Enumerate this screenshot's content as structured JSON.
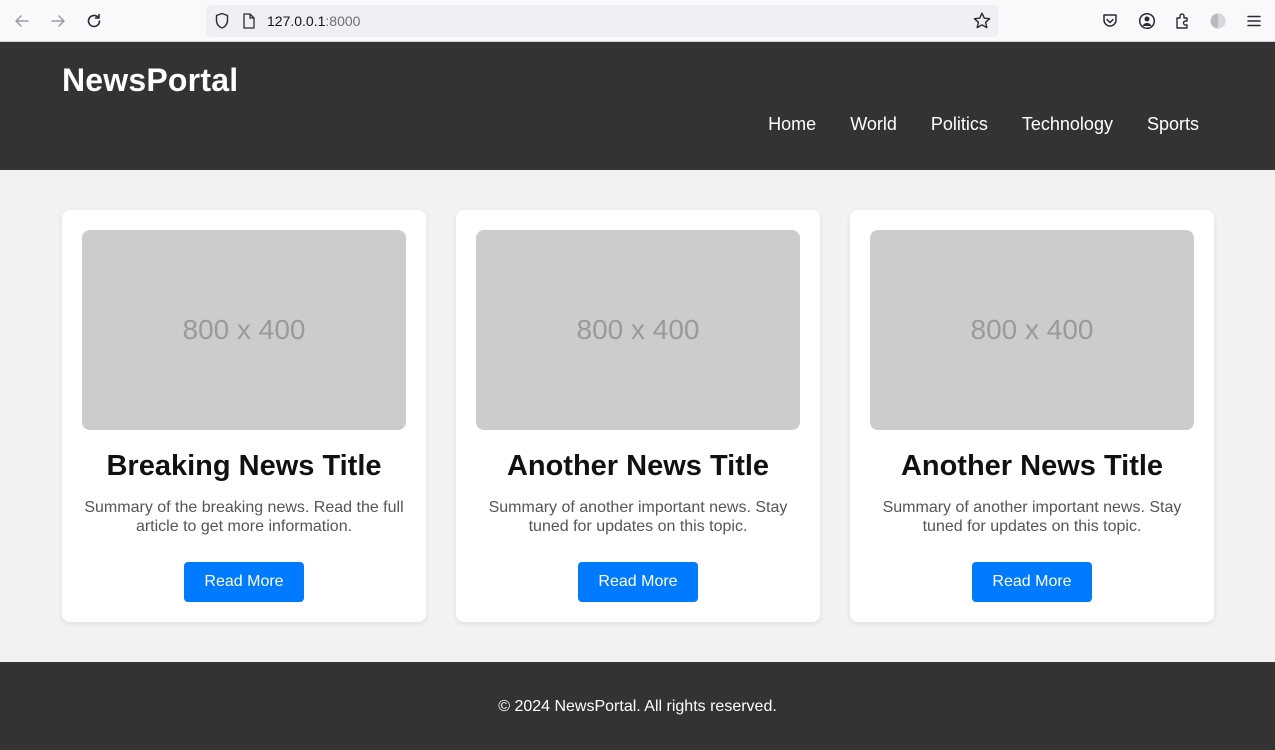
{
  "browser": {
    "url_host": "127.0.0.1",
    "url_port": ":8000",
    "icons": [
      "back-icon",
      "forward-icon",
      "reload-icon",
      "shield-icon",
      "page-icon",
      "star-icon",
      "pocket-icon",
      "account-icon",
      "extensions-icon",
      "profile-icon",
      "menu-icon"
    ]
  },
  "header": {
    "logo": "NewsPortal",
    "nav": [
      "Home",
      "World",
      "Politics",
      "Technology",
      "Sports"
    ]
  },
  "cards": [
    {
      "image_label": "800 x 400",
      "title": "Breaking News Title",
      "summary": "Summary of the breaking news. Read the full article to get more information.",
      "button": "Read More"
    },
    {
      "image_label": "800 x 400",
      "title": "Another News Title",
      "summary": "Summary of another important news. Stay tuned for updates on this topic.",
      "button": "Read More"
    },
    {
      "image_label": "800 x 400",
      "title": "Another News Title",
      "summary": "Summary of another important news. Stay tuned for updates on this topic.",
      "button": "Read More"
    }
  ],
  "footer": {
    "text": "© 2024 NewsPortal. All rights reserved."
  },
  "colors": {
    "header_bg": "#333333",
    "page_bg": "#f2f2f2",
    "accent": "#007bff",
    "placeholder": "#cccccc"
  }
}
